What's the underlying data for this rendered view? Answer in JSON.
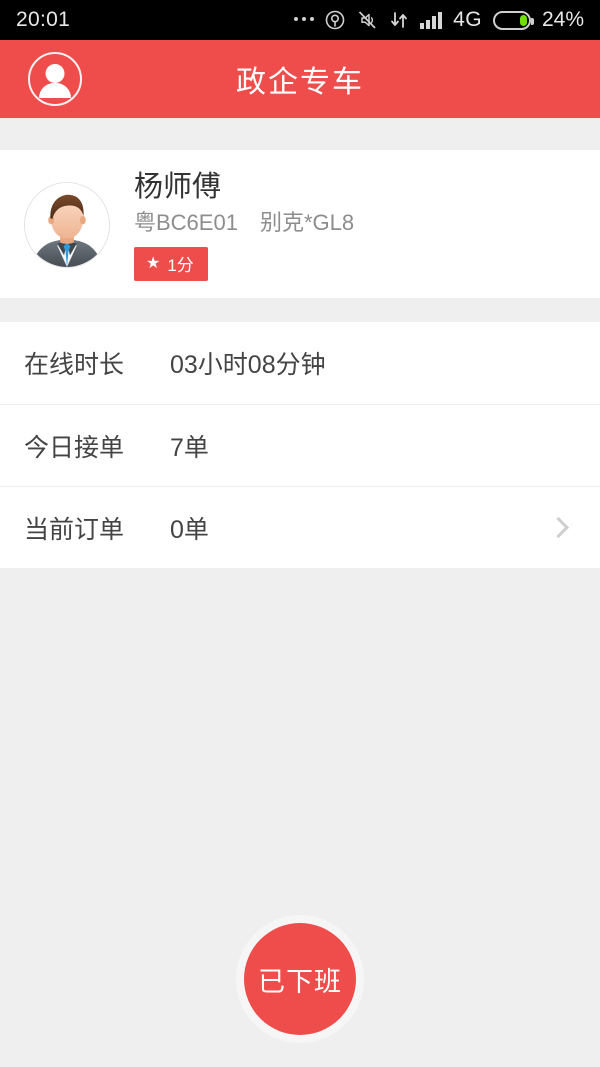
{
  "status_bar": {
    "time": "20:01",
    "icons": [
      "more-dots-icon",
      "location-icon",
      "mute-icon",
      "data-transfer-icon",
      "signal-bars-icon"
    ],
    "network": "4G",
    "battery_percent": "24%",
    "battery_level": 24
  },
  "header": {
    "title": "政企专车",
    "avatar_icon": "user-circle-icon"
  },
  "profile": {
    "name": "杨师傅",
    "vehicle": "粤BC6E01　别克*GL8",
    "rating_badge": "1分",
    "star_glyph": "★",
    "avatar_icon": "driver-photo"
  },
  "stats": [
    {
      "label": "在线时长",
      "value": "03小时08分钟",
      "has_chevron": false
    },
    {
      "label": "今日接单",
      "value": "7单",
      "has_chevron": false
    },
    {
      "label": "当前订单",
      "value": "0单",
      "has_chevron": true
    }
  ],
  "duty_button": {
    "label": "已下班"
  },
  "colors": {
    "brand_red": "#ef4c4c",
    "page_bg": "#efefef",
    "card_bg": "#ffffff",
    "text_primary": "#444444",
    "text_secondary": "#8d8d8d",
    "battery_green": "#6fe000",
    "divider": "#ededed"
  }
}
